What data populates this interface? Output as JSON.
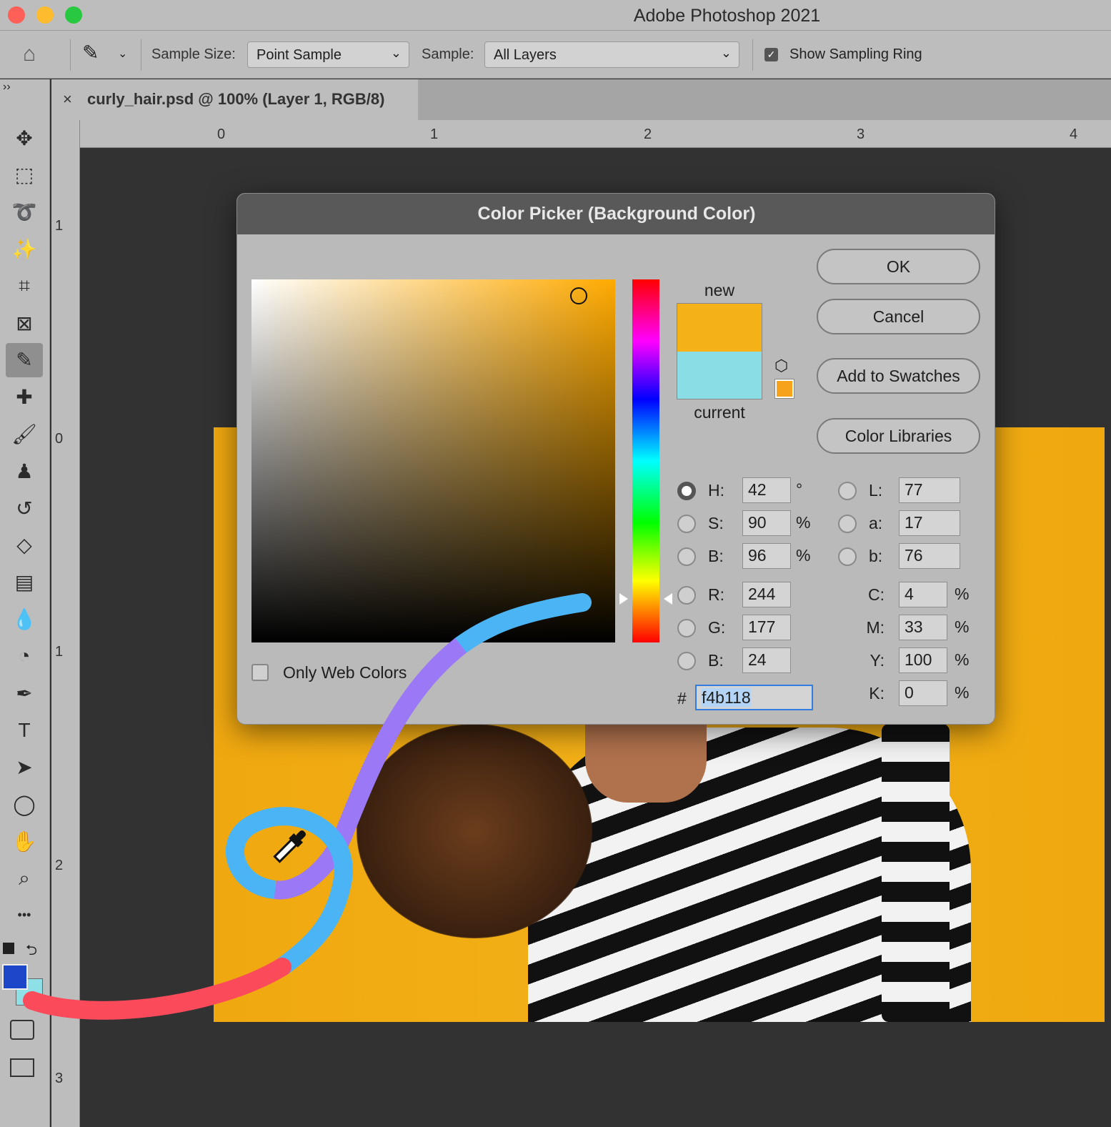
{
  "app": {
    "title": "Adobe Photoshop 2021"
  },
  "options": {
    "sample_size_label": "Sample Size:",
    "sample_size_value": "Point Sample",
    "sample_label": "Sample:",
    "sample_value": "All Layers",
    "show_ring_label": "Show Sampling Ring",
    "show_ring_checked": true
  },
  "document": {
    "tab_title": "curly_hair.psd @ 100% (Layer 1, RGB/8)",
    "close": "×"
  },
  "ruler": {
    "h": [
      "0",
      "1",
      "2",
      "3",
      "4"
    ],
    "v": [
      "1",
      "0",
      "1",
      "2",
      "3"
    ]
  },
  "tools": [
    "move",
    "rect-marquee",
    "lasso",
    "magic-wand",
    "crop",
    "frame",
    "eyedropper",
    "healing",
    "brush",
    "stamp",
    "history-brush",
    "eraser",
    "gradient",
    "blur",
    "dodge",
    "pen",
    "type",
    "path-select",
    "ellipse",
    "hand",
    "zoom",
    "more"
  ],
  "colors": {
    "foreground": "#1b47c8",
    "background": "#8ee0e6",
    "new": "#f4b118",
    "current": "#8bdde5"
  },
  "dialog": {
    "title": "Color Picker (Background Color)",
    "new_label": "new",
    "current_label": "current",
    "buttons": {
      "ok": "OK",
      "cancel": "Cancel",
      "add": "Add to Swatches",
      "libraries": "Color Libraries"
    },
    "only_web_label": "Only Web Colors",
    "only_web_checked": false,
    "hsb": [
      {
        "label": "H:",
        "value": "42",
        "unit": "°",
        "selected": true
      },
      {
        "label": "S:",
        "value": "90",
        "unit": "%"
      },
      {
        "label": "B:",
        "value": "96",
        "unit": "%"
      }
    ],
    "rgb": [
      {
        "label": "R:",
        "value": "244"
      },
      {
        "label": "G:",
        "value": "177"
      },
      {
        "label": "B:",
        "value": "24"
      }
    ],
    "lab": [
      {
        "label": "L:",
        "value": "77"
      },
      {
        "label": "a:",
        "value": "17"
      },
      {
        "label": "b:",
        "value": "76"
      }
    ],
    "cmyk": [
      {
        "label": "C:",
        "value": "4",
        "unit": "%"
      },
      {
        "label": "M:",
        "value": "33",
        "unit": "%"
      },
      {
        "label": "Y:",
        "value": "100",
        "unit": "%"
      },
      {
        "label": "K:",
        "value": "0",
        "unit": "%"
      }
    ],
    "hex_label": "#",
    "hex": "f4b118"
  }
}
